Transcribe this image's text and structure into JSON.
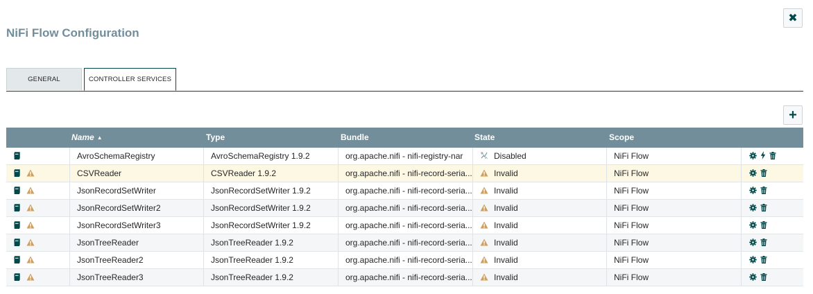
{
  "dialog": {
    "title": "NiFi Flow Configuration",
    "close_icon": "close-icon"
  },
  "tabs": [
    {
      "label": "GENERAL",
      "active": false
    },
    {
      "label": "CONTROLLER SERVICES",
      "active": true
    }
  ],
  "toolbar": {
    "add_icon": "plus-icon"
  },
  "table": {
    "columns": [
      "",
      "Name",
      "Type",
      "Bundle",
      "State",
      "Scope",
      ""
    ],
    "sort": {
      "column": "Name",
      "direction": "ascending",
      "indicator": "▲"
    },
    "rows": [
      {
        "name": "AvroSchemaRegistry",
        "type": "AvroSchemaRegistry 1.9.2",
        "bundle": "org.apache.nifi - nifi-registry-nar",
        "state": "Disabled",
        "scope": "NiFi Flow",
        "warning": false,
        "actions": [
          "configure",
          "enable",
          "delete"
        ]
      },
      {
        "name": "CSVReader",
        "type": "CSVReader 1.9.2",
        "bundle": "org.apache.nifi - nifi-record-seria...",
        "state": "Invalid",
        "scope": "NiFi Flow",
        "warning": true,
        "actions": [
          "configure",
          "delete"
        ]
      },
      {
        "name": "JsonRecordSetWriter",
        "type": "JsonRecordSetWriter 1.9.2",
        "bundle": "org.apache.nifi - nifi-record-seria...",
        "state": "Invalid",
        "scope": "NiFi Flow",
        "warning": true,
        "actions": [
          "configure",
          "delete"
        ]
      },
      {
        "name": "JsonRecordSetWriter2",
        "type": "JsonRecordSetWriter 1.9.2",
        "bundle": "org.apache.nifi - nifi-record-seria...",
        "state": "Invalid",
        "scope": "NiFi Flow",
        "warning": true,
        "actions": [
          "configure",
          "delete"
        ]
      },
      {
        "name": "JsonRecordSetWriter3",
        "type": "JsonRecordSetWriter 1.9.2",
        "bundle": "org.apache.nifi - nifi-record-seria...",
        "state": "Invalid",
        "scope": "NiFi Flow",
        "warning": true,
        "actions": [
          "configure",
          "delete"
        ]
      },
      {
        "name": "JsonTreeReader",
        "type": "JsonTreeReader 1.9.2",
        "bundle": "org.apache.nifi - nifi-record-seria...",
        "state": "Invalid",
        "scope": "NiFi Flow",
        "warning": true,
        "actions": [
          "configure",
          "delete"
        ]
      },
      {
        "name": "JsonTreeReader2",
        "type": "JsonTreeReader 1.9.2",
        "bundle": "org.apache.nifi - nifi-record-seria...",
        "state": "Invalid",
        "scope": "NiFi Flow",
        "warning": true,
        "actions": [
          "configure",
          "delete"
        ]
      },
      {
        "name": "JsonTreeReader3",
        "type": "JsonTreeReader 1.9.2",
        "bundle": "org.apache.nifi - nifi-record-seria...",
        "state": "Invalid",
        "scope": "NiFi Flow",
        "warning": true,
        "actions": [
          "configure",
          "delete"
        ]
      }
    ]
  },
  "colors": {
    "header_bg": "#728e9b",
    "accent": "#004849",
    "warning": "#cf9f5d",
    "selected_row": "#fcf8e3"
  }
}
